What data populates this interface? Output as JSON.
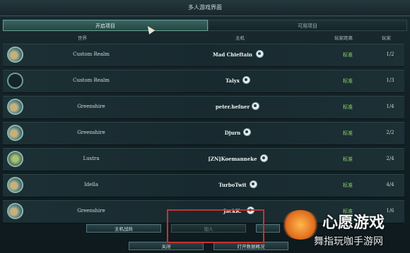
{
  "window": {
    "title": "多人游戏界面"
  },
  "tabs": [
    {
      "label": "开启项目",
      "active": true
    },
    {
      "label": "可用项目",
      "active": false
    }
  ],
  "columns": {
    "world": "世界",
    "host": "主机",
    "speed": "玩家距离",
    "players": "玩家"
  },
  "rows": [
    {
      "world": "Custom Realm",
      "host": "Mad Chieftain",
      "speed": "标准",
      "players": "1/2",
      "avatar": "terrain"
    },
    {
      "world": "Custom Realm",
      "host": "Talyx",
      "speed": "标准",
      "players": "1/3",
      "avatar": "empty"
    },
    {
      "world": "Greenshire",
      "host": "peter.hefner",
      "speed": "标准",
      "players": "1/4",
      "avatar": "terrain"
    },
    {
      "world": "Greenshire",
      "host": "Djurn",
      "speed": "标准",
      "players": "2/2",
      "avatar": "terrain"
    },
    {
      "world": "Lustra",
      "host": "[ZN]Koemanneke",
      "speed": "标准",
      "players": "2/4",
      "avatar": "green"
    },
    {
      "world": "Idella",
      "host": "TurboTwit",
      "speed": "标准",
      "players": "4/4",
      "avatar": "terrain"
    },
    {
      "world": "Greenshire",
      "host": "JackK.",
      "speed": "标准",
      "players": "1/6",
      "avatar": "terrain"
    }
  ],
  "buttons": {
    "host_game": "主机战局",
    "join": "加入",
    "close": "关闭",
    "open_data": "打开数据概况"
  },
  "watermark": {
    "title": "心愿游戏",
    "subtitle": "舞指玩咖手游网"
  },
  "colors": {
    "speed_standard": "#8fd36a",
    "highlight": "#c8322e"
  }
}
